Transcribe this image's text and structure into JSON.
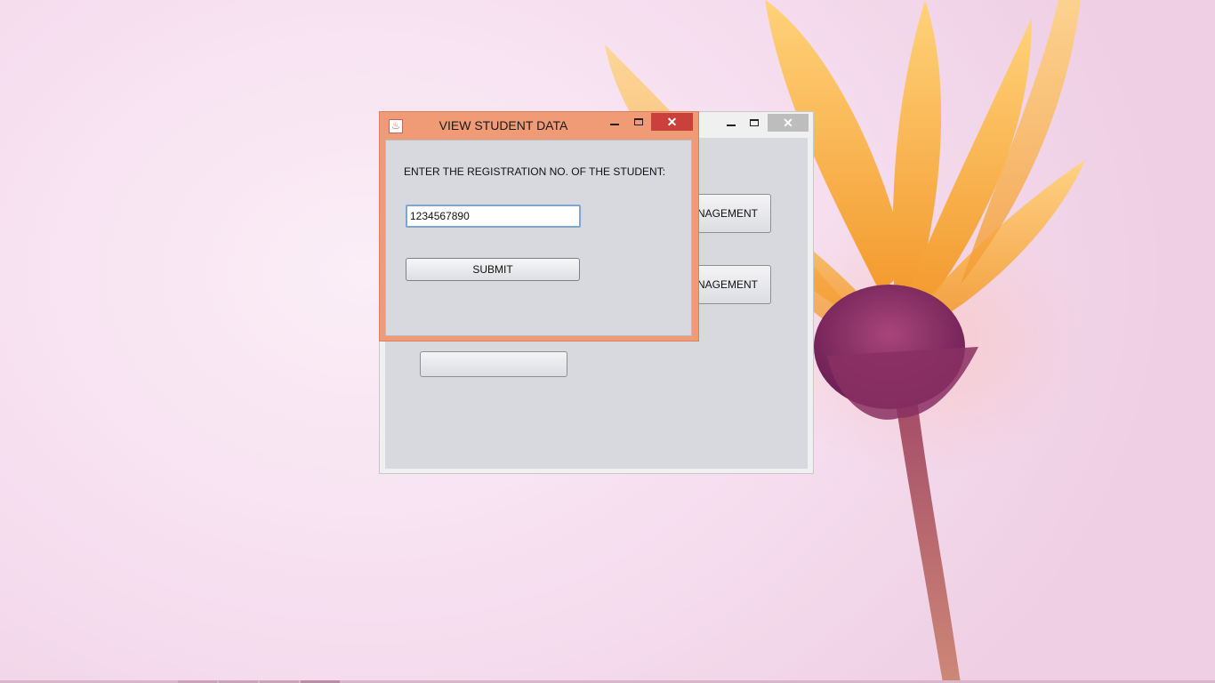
{
  "desktop": {
    "wallpaper_icon": "flower-wallpaper"
  },
  "main_window": {
    "minimize_icon": "minimize-icon",
    "maximize_icon": "maximize-icon",
    "close_glyph": "✕",
    "buttons": [
      {
        "label": "NAGEMENT"
      },
      {
        "label": "NAGEMENT"
      },
      {
        "label": ""
      }
    ]
  },
  "dialog": {
    "title": "VIEW STUDENT DATA",
    "app_icon": "java-icon",
    "close_glyph": "✕",
    "prompt_label": "ENTER THE REGISTRATION NO. OF THE STUDENT:",
    "registration_input": {
      "value": "1234567890",
      "placeholder": ""
    },
    "submit_label": "SUBMIT"
  },
  "colors": {
    "dialog_frame": "#f09a76",
    "dialog_close": "#c9413a",
    "client_bg": "#d7d9de",
    "input_focus_border": "#7ea6cf"
  }
}
